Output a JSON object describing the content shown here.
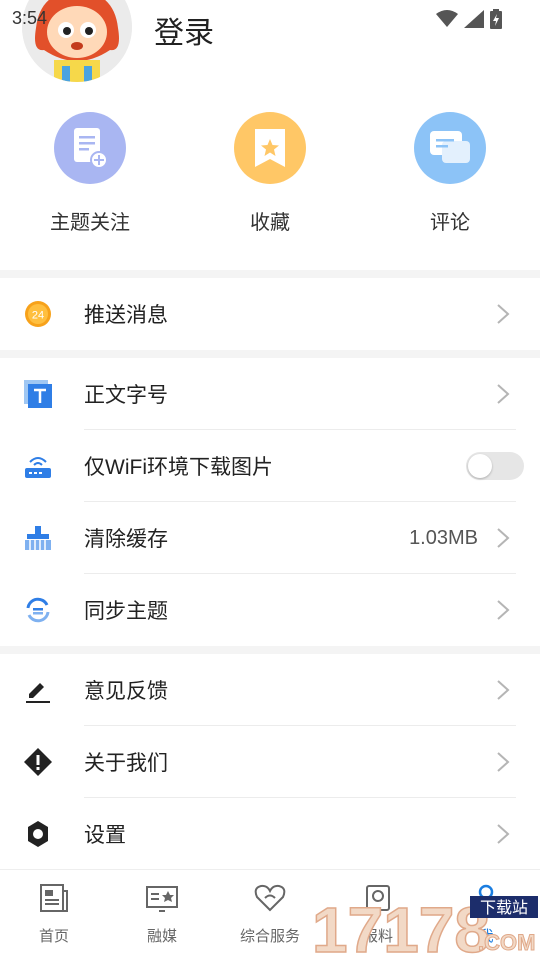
{
  "status_bar": {
    "time": "3:54"
  },
  "header": {
    "login": "登录"
  },
  "quick_actions": [
    {
      "label": "主题关注",
      "icon": "topic-add-icon",
      "color": "#a9b6f2"
    },
    {
      "label": "收藏",
      "icon": "bookmark-star-icon",
      "color": "#ffc766"
    },
    {
      "label": "评论",
      "icon": "comment-icon",
      "color": "#8cc3f7"
    }
  ],
  "settings": {
    "push": "推送消息",
    "push_badge": "24",
    "font_size": "正文字号",
    "wifi_images": "仅WiFi环境下载图片",
    "wifi_images_on": false,
    "clear_cache": "清除缓存",
    "cache_size": "1.03MB",
    "sync_topics": "同步主题",
    "feedback": "意见反馈",
    "about": "关于我们",
    "settings": "设置"
  },
  "tabbar": {
    "items": [
      {
        "label": "首页",
        "icon": "news-icon"
      },
      {
        "label": "融媒",
        "icon": "media-icon"
      },
      {
        "label": "综合服务",
        "icon": "service-heart-icon"
      },
      {
        "label": "报料",
        "icon": "report-icon"
      },
      {
        "label": "我",
        "icon": "user-icon"
      }
    ],
    "active": 4
  },
  "watermark": {
    "text": "17178",
    "sub": "下载站",
    "com": ".COM"
  },
  "colors": {
    "accent": "#1a7de0",
    "icon_blue": "#2f7ee6"
  }
}
